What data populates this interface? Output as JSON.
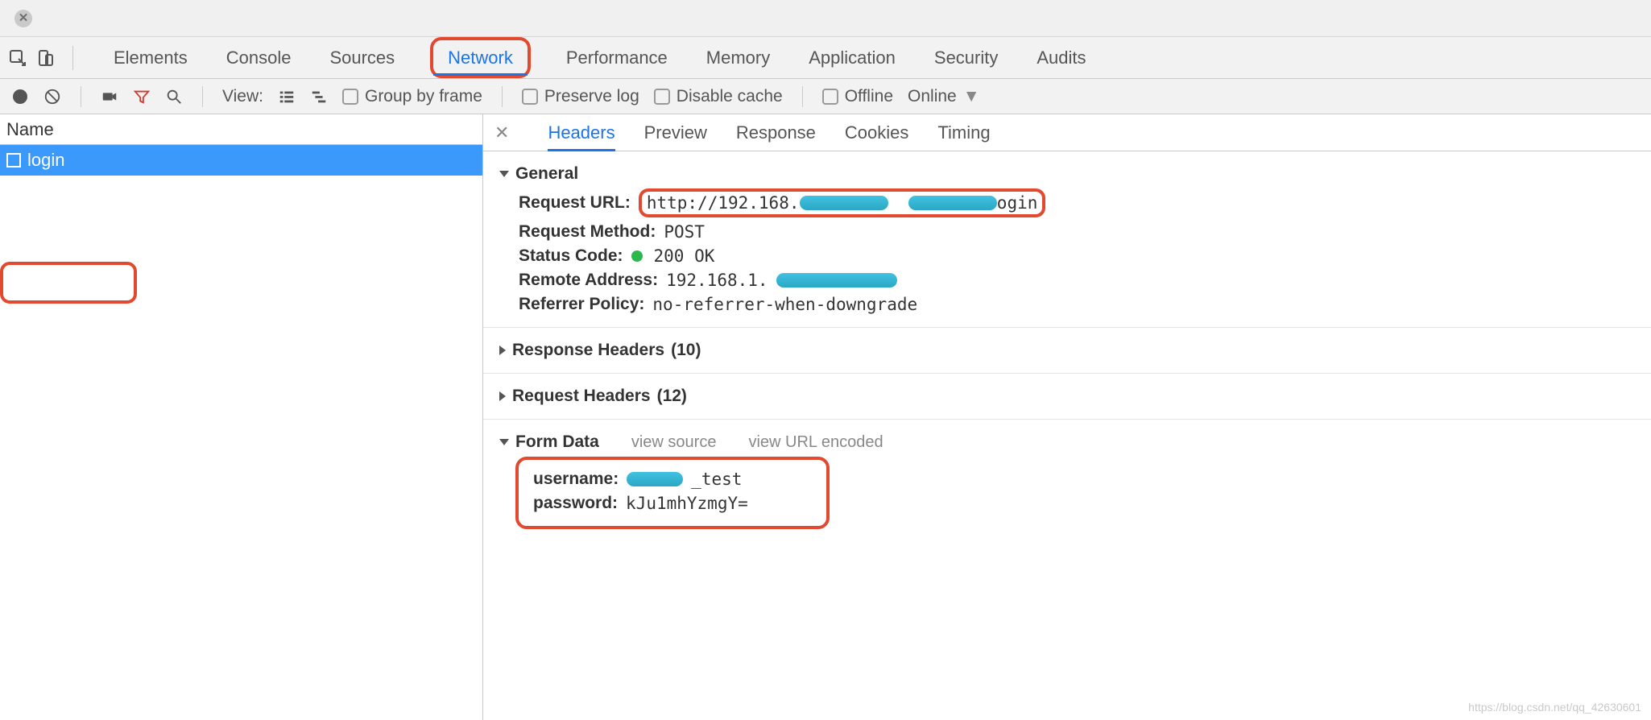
{
  "titlebar": {
    "close_glyph": "✕"
  },
  "panel_tabs": {
    "items": [
      "Elements",
      "Console",
      "Sources",
      "Network",
      "Performance",
      "Memory",
      "Application",
      "Security",
      "Audits"
    ],
    "active": "Network"
  },
  "network_toolbar": {
    "view_label": "View:",
    "group_by_frame": "Group by frame",
    "preserve_log": "Preserve log",
    "disable_cache": "Disable cache",
    "offline": "Offline",
    "online": "Online"
  },
  "left": {
    "header": "Name",
    "request_name": "login"
  },
  "detail_tabs": {
    "items": [
      "Headers",
      "Preview",
      "Response",
      "Cookies",
      "Timing"
    ],
    "active": "Headers"
  },
  "sections": {
    "general": {
      "title": "General",
      "request_url_label": "Request URL:",
      "request_url_prefix": "http://192.168.",
      "request_url_suffix": "ogin",
      "request_method_label": "Request Method:",
      "request_method_value": "POST",
      "status_code_label": "Status Code:",
      "status_code_value": "200 OK",
      "remote_address_label": "Remote Address:",
      "remote_address_prefix": "192.168.1.",
      "referrer_policy_label": "Referrer Policy:",
      "referrer_policy_value": "no-referrer-when-downgrade"
    },
    "response_headers": {
      "title": "Response Headers",
      "count_suffix": "(10)"
    },
    "request_headers": {
      "title": "Request Headers",
      "count_suffix": "(12)"
    },
    "form_data": {
      "title": "Form Data",
      "view_source": "view source",
      "view_url_encoded": "view URL encoded",
      "username_label": "username:",
      "username_suffix": "_test",
      "password_label": "password:",
      "password_value": "kJu1mhYzmgY="
    }
  },
  "watermark": "https://blog.csdn.net/qq_42630601"
}
